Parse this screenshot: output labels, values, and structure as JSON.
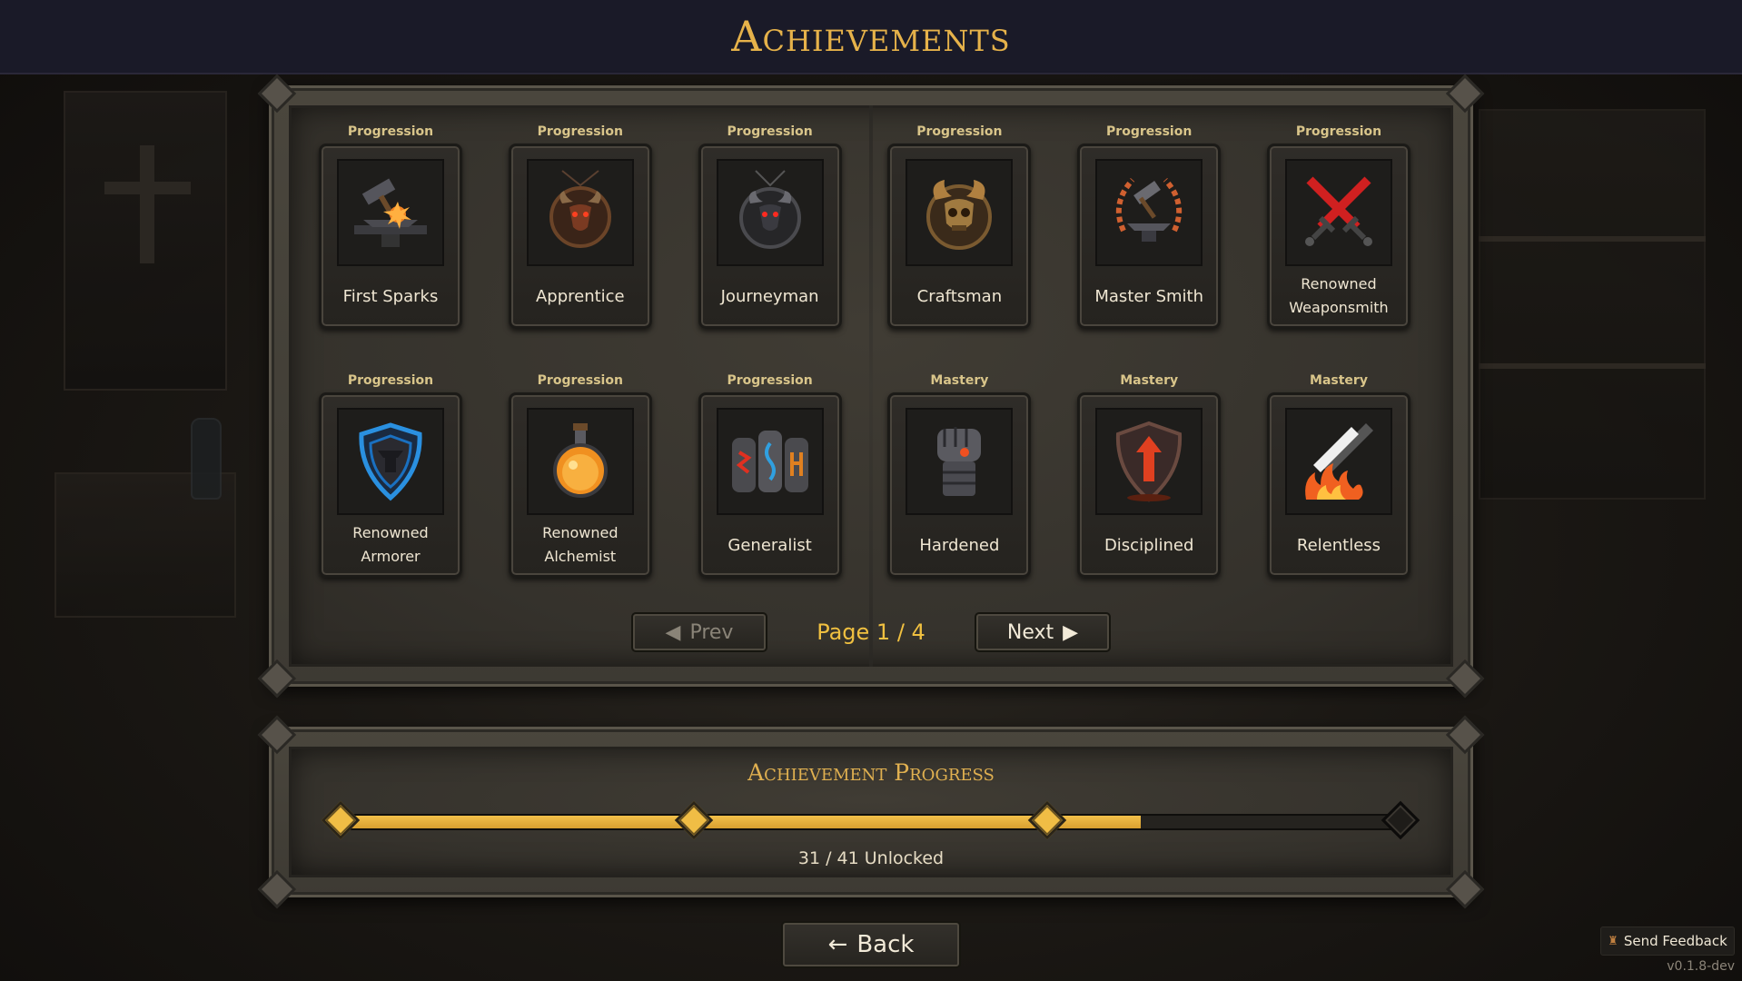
{
  "header": {
    "title": "Achievements"
  },
  "achievements": [
    {
      "category": "Progression",
      "name": "First Sparks",
      "icon": "anvil-spark-icon"
    },
    {
      "category": "Progression",
      "name": "Apprentice",
      "icon": "bull-amulet-icon"
    },
    {
      "category": "Progression",
      "name": "Journeyman",
      "icon": "demon-amulet-icon"
    },
    {
      "category": "Progression",
      "name": "Craftsman",
      "icon": "horned-skull-icon"
    },
    {
      "category": "Progression",
      "name": "Master Smith",
      "icon": "laurel-anvil-icon"
    },
    {
      "category": "Progression",
      "name": "Renowned Weaponsmith",
      "icon": "crossed-swords-icon"
    },
    {
      "category": "Progression",
      "name": "Renowned Armorer",
      "icon": "shield-icon"
    },
    {
      "category": "Progression",
      "name": "Renowned Alchemist",
      "icon": "potion-icon"
    },
    {
      "category": "Progression",
      "name": "Generalist",
      "icon": "rune-stones-icon"
    },
    {
      "category": "Mastery",
      "name": "Hardened",
      "icon": "gauntlet-fist-icon"
    },
    {
      "category": "Mastery",
      "name": "Disciplined",
      "icon": "arrow-shield-icon"
    },
    {
      "category": "Mastery",
      "name": "Relentless",
      "icon": "flaming-blade-icon"
    }
  ],
  "pagination": {
    "prev_label": "Prev",
    "next_label": "Next",
    "page_text": "Page 1 / 4",
    "current": 1,
    "total": 4
  },
  "progress": {
    "title": "Achievement Progress",
    "unlocked": 31,
    "total": 41,
    "count_text": "31 / 41 Unlocked",
    "milestones_reached": [
      true,
      true,
      true,
      false
    ]
  },
  "back_label": "Back",
  "back_icon": "left-arrow-icon",
  "feedback_label": "Send Feedback",
  "version": "v0.1.8-dev",
  "colors": {
    "gold": "#f0c040",
    "title_gold": "#e6b24a",
    "bar_fill": "#f3c04a"
  }
}
